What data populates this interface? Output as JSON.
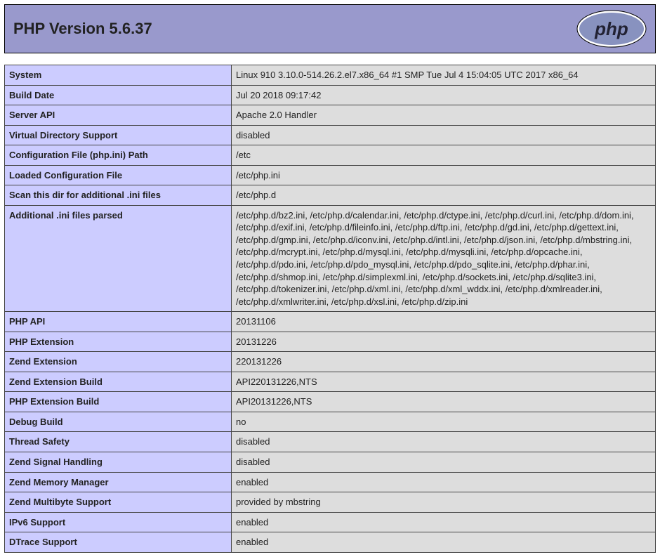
{
  "header": {
    "title": "PHP Version 5.6.37",
    "logo_text": "php"
  },
  "rows": [
    {
      "key": "System",
      "value": "Linux 910 3.10.0-514.26.2.el7.x86_64 #1 SMP Tue Jul 4 15:04:05 UTC 2017 x86_64"
    },
    {
      "key": "Build Date",
      "value": "Jul 20 2018 09:17:42"
    },
    {
      "key": "Server API",
      "value": "Apache 2.0 Handler"
    },
    {
      "key": "Virtual Directory Support",
      "value": "disabled"
    },
    {
      "key": "Configuration File (php.ini) Path",
      "value": "/etc"
    },
    {
      "key": "Loaded Configuration File",
      "value": "/etc/php.ini"
    },
    {
      "key": "Scan this dir for additional .ini files",
      "value": "/etc/php.d"
    },
    {
      "key": "Additional .ini files parsed",
      "value": "/etc/php.d/bz2.ini, /etc/php.d/calendar.ini, /etc/php.d/ctype.ini, /etc/php.d/curl.ini, /etc/php.d/dom.ini, /etc/php.d/exif.ini, /etc/php.d/fileinfo.ini, /etc/php.d/ftp.ini, /etc/php.d/gd.ini, /etc/php.d/gettext.ini, /etc/php.d/gmp.ini, /etc/php.d/iconv.ini, /etc/php.d/intl.ini, /etc/php.d/json.ini, /etc/php.d/mbstring.ini, /etc/php.d/mcrypt.ini, /etc/php.d/mysql.ini, /etc/php.d/mysqli.ini, /etc/php.d/opcache.ini, /etc/php.d/pdo.ini, /etc/php.d/pdo_mysql.ini, /etc/php.d/pdo_sqlite.ini, /etc/php.d/phar.ini, /etc/php.d/shmop.ini, /etc/php.d/simplexml.ini, /etc/php.d/sockets.ini, /etc/php.d/sqlite3.ini, /etc/php.d/tokenizer.ini, /etc/php.d/xml.ini, /etc/php.d/xml_wddx.ini, /etc/php.d/xmlreader.ini, /etc/php.d/xmlwriter.ini, /etc/php.d/xsl.ini, /etc/php.d/zip.ini"
    },
    {
      "key": "PHP API",
      "value": "20131106"
    },
    {
      "key": "PHP Extension",
      "value": "20131226"
    },
    {
      "key": "Zend Extension",
      "value": "220131226"
    },
    {
      "key": "Zend Extension Build",
      "value": "API220131226,NTS"
    },
    {
      "key": "PHP Extension Build",
      "value": "API20131226,NTS"
    },
    {
      "key": "Debug Build",
      "value": "no"
    },
    {
      "key": "Thread Safety",
      "value": "disabled"
    },
    {
      "key": "Zend Signal Handling",
      "value": "disabled"
    },
    {
      "key": "Zend Memory Manager",
      "value": "enabled"
    },
    {
      "key": "Zend Multibyte Support",
      "value": "provided by mbstring"
    },
    {
      "key": "IPv6 Support",
      "value": "enabled"
    },
    {
      "key": "DTrace Support",
      "value": "enabled"
    }
  ]
}
